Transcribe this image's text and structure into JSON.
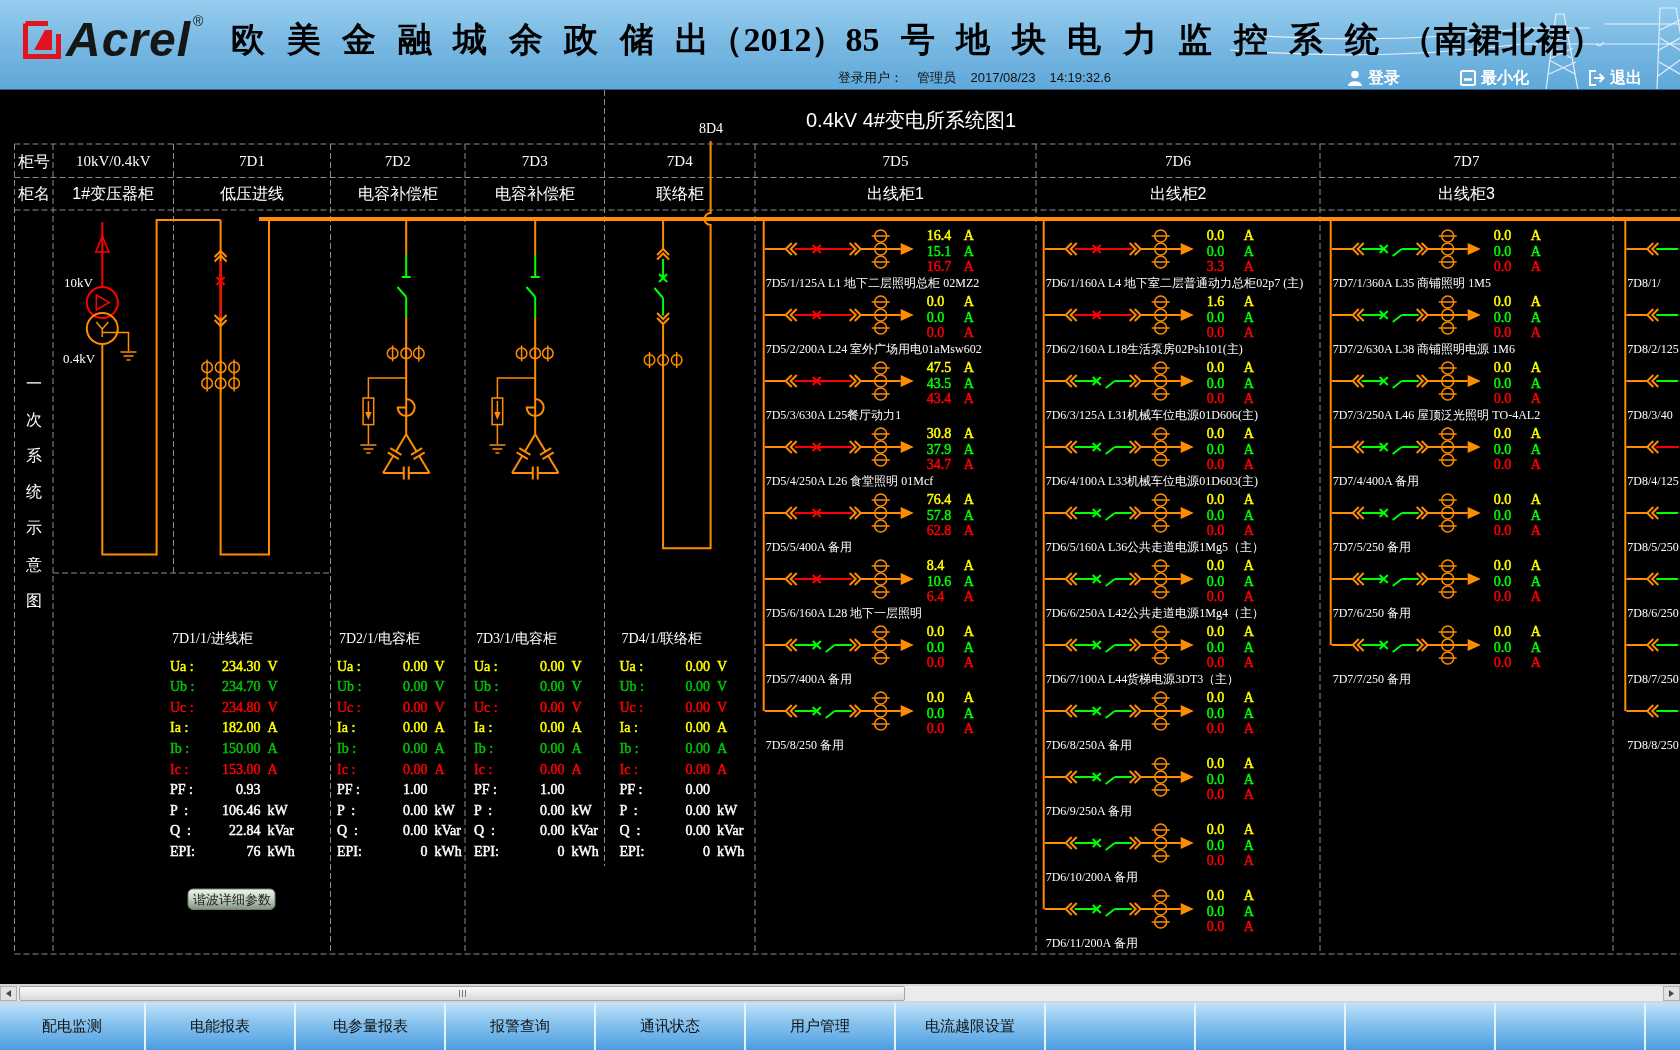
{
  "header": {
    "logo": "Acrel",
    "logo_mark": "®",
    "title": "欧 美 金 融 城 余 政 储 出（2012）85 号 地 块 电 力 监 控 系 统 （南裙北裙）",
    "user_label": "登录用户：",
    "user": "管理员",
    "date": "2017/08/23",
    "time": "14:19:32.6",
    "buttons": [
      {
        "kind": "login",
        "label": "登录"
      },
      {
        "kind": "minimize",
        "label": "最小化"
      },
      {
        "kind": "exit",
        "label": "退出"
      }
    ]
  },
  "diagram": {
    "title": "0.4kV 4#变电所系统图1",
    "side_label": "一次系统示意图",
    "row_labels": [
      "柜号",
      "柜名"
    ],
    "cabinets": [
      {
        "kind": "transformer",
        "number": "10kV/0.4kV",
        "name": "1#变压器柜",
        "hv_label": "10kV",
        "lv_label": "0.4kV"
      },
      {
        "kind": "incoming",
        "number": "7D1",
        "name": "低压进线",
        "closed": true,
        "button": "谐波详细参数",
        "meter": {
          "title": "7D1/1/进线柜",
          "rows": [
            {
              "label": "Ua :",
              "value": "234.30",
              "unit": "V",
              "color": "#ffff00"
            },
            {
              "label": "Ub :",
              "value": "234.70",
              "unit": "V",
              "color": "#00c800"
            },
            {
              "label": "Uc :",
              "value": "234.80",
              "unit": "V",
              "color": "#ff0000"
            },
            {
              "label": "Ia :",
              "value": "182.00",
              "unit": "A",
              "color": "#ffff00"
            },
            {
              "label": "Ib :",
              "value": "150.00",
              "unit": "A",
              "color": "#00c800"
            },
            {
              "label": "Ic :",
              "value": "153.00",
              "unit": "A",
              "color": "#ff0000"
            },
            {
              "label": "PF :",
              "value": "0.93",
              "color": "#ffffff"
            },
            {
              "label": "P  :",
              "value": "106.46",
              "unit": "kW",
              "color": "#ffffff"
            },
            {
              "label": "Q  :",
              "value": "22.84",
              "unit": "kVar",
              "color": "#ffffff"
            },
            {
              "label": "EPI:",
              "value": "76",
              "unit": "kWh",
              "color": "#ffffff"
            }
          ]
        }
      },
      {
        "kind": "capacitor",
        "number": "7D2",
        "name": "电容补偿柜",
        "closed": false,
        "meter": {
          "title": "7D2/1/电容柜",
          "rows": [
            {
              "label": "Ua :",
              "value": "0.00",
              "unit": "V",
              "color": "#ffff00"
            },
            {
              "label": "Ub :",
              "value": "0.00",
              "unit": "V",
              "color": "#00c800"
            },
            {
              "label": "Uc :",
              "value": "0.00",
              "unit": "V",
              "color": "#ff0000"
            },
            {
              "label": "Ia :",
              "value": "0.00",
              "unit": "A",
              "color": "#ffff00"
            },
            {
              "label": "Ib :",
              "value": "0.00",
              "unit": "A",
              "color": "#00c800"
            },
            {
              "label": "Ic :",
              "value": "0.00",
              "unit": "A",
              "color": "#ff0000"
            },
            {
              "label": "PF :",
              "value": "1.00",
              "color": "#ffffff"
            },
            {
              "label": "P  :",
              "value": "0.00",
              "unit": "kW",
              "color": "#ffffff"
            },
            {
              "label": "Q  :",
              "value": "0.00",
              "unit": "kVar",
              "color": "#ffffff"
            },
            {
              "label": "EPI:",
              "value": "0",
              "unit": "kWh",
              "color": "#ffffff"
            }
          ]
        }
      },
      {
        "kind": "capacitor",
        "number": "7D3",
        "name": "电容补偿柜",
        "closed": false,
        "meter": {
          "title": "7D3/1/电容柜",
          "rows": [
            {
              "label": "Ua :",
              "value": "0.00",
              "unit": "V",
              "color": "#ffff00"
            },
            {
              "label": "Ub :",
              "value": "0.00",
              "unit": "V",
              "color": "#00c800"
            },
            {
              "label": "Uc :",
              "value": "0.00",
              "unit": "V",
              "color": "#ff0000"
            },
            {
              "label": "Ia :",
              "value": "0.00",
              "unit": "A",
              "color": "#ffff00"
            },
            {
              "label": "Ib :",
              "value": "0.00",
              "unit": "A",
              "color": "#00c800"
            },
            {
              "label": "Ic :",
              "value": "0.00",
              "unit": "A",
              "color": "#ff0000"
            },
            {
              "label": "PF :",
              "value": "1.00",
              "color": "#ffffff"
            },
            {
              "label": "P  :",
              "value": "0.00",
              "unit": "kW",
              "color": "#ffffff"
            },
            {
              "label": "Q  :",
              "value": "0.00",
              "unit": "kVar",
              "color": "#ffffff"
            },
            {
              "label": "EPI:",
              "value": "0",
              "unit": "kWh",
              "color": "#ffffff"
            }
          ]
        }
      },
      {
        "kind": "tie",
        "number": "7D4",
        "name": "联络柜",
        "closed": false,
        "tie_label": "8D4",
        "meter": {
          "title": "7D4/1/联络柜",
          "rows": [
            {
              "label": "Ua :",
              "value": "0.00",
              "unit": "V",
              "color": "#ffff00"
            },
            {
              "label": "Ub :",
              "value": "0.00",
              "unit": "V",
              "color": "#00c800"
            },
            {
              "label": "Uc :",
              "value": "0.00",
              "unit": "V",
              "color": "#ff0000"
            },
            {
              "label": "Ia :",
              "value": "0.00",
              "unit": "A",
              "color": "#ffff00"
            },
            {
              "label": "Ib :",
              "value": "0.00",
              "unit": "A",
              "color": "#00c800"
            },
            {
              "label": "Ic :",
              "value": "0.00",
              "unit": "A",
              "color": "#ff0000"
            },
            {
              "label": "PF :",
              "value": "0.00",
              "color": "#ffffff"
            },
            {
              "label": "P  :",
              "value": "0.00",
              "unit": "kW",
              "color": "#ffffff"
            },
            {
              "label": "Q  :",
              "value": "0.00",
              "unit": "kVar",
              "color": "#ffffff"
            },
            {
              "label": "EPI:",
              "value": "0",
              "unit": "kWh",
              "color": "#ffffff"
            }
          ]
        }
      },
      {
        "kind": "feeders",
        "number": "7D5",
        "name": "出线柜1",
        "feeders": [
          {
            "label": "7D5/1/125A L1 地下二层照明总柜 02MZ2",
            "closed": true,
            "readings": [
              {
                "value": "16.4",
                "unit": "A",
                "color": "#ffff00"
              },
              {
                "value": "15.1",
                "unit": "A",
                "color": "#00ff00"
              },
              {
                "value": "16.7",
                "unit": "A",
                "color": "#ff0000"
              }
            ]
          },
          {
            "label": "7D5/2/200A L24 室外广场用电01aMsw602",
            "closed": true,
            "readings": [
              {
                "value": "0.0",
                "unit": "A",
                "color": "#ffff00"
              },
              {
                "value": "0.0",
                "unit": "A",
                "color": "#00ff00"
              },
              {
                "value": "0.0",
                "unit": "A",
                "color": "#ff0000"
              }
            ]
          },
          {
            "label": "7D5/3/630A L25餐厅动力1",
            "closed": true,
            "readings": [
              {
                "value": "47.5",
                "unit": "A",
                "color": "#ffff00"
              },
              {
                "value": "43.5",
                "unit": "A",
                "color": "#00ff00"
              },
              {
                "value": "43.4",
                "unit": "A",
                "color": "#ff0000"
              }
            ]
          },
          {
            "label": "7D5/4/250A L26 食堂照明 01Mcf",
            "closed": true,
            "readings": [
              {
                "value": "30.8",
                "unit": "A",
                "color": "#ffff00"
              },
              {
                "value": "37.9",
                "unit": "A",
                "color": "#00ff00"
              },
              {
                "value": "34.7",
                "unit": "A",
                "color": "#ff0000"
              }
            ]
          },
          {
            "label": "7D5/5/400A 备用",
            "closed": true,
            "readings": [
              {
                "value": "76.4",
                "unit": "A",
                "color": "#ffff00"
              },
              {
                "value": "57.8",
                "unit": "A",
                "color": "#00ff00"
              },
              {
                "value": "62.8",
                "unit": "A",
                "color": "#ff0000"
              }
            ]
          },
          {
            "label": "7D5/6/160A L28 地下一层照明",
            "closed": true,
            "readings": [
              {
                "value": "8.4",
                "unit": "A",
                "color": "#ffff00"
              },
              {
                "value": "10.6",
                "unit": "A",
                "color": "#00ff00"
              },
              {
                "value": "6.4",
                "unit": "A",
                "color": "#ff0000"
              }
            ]
          },
          {
            "label": "7D5/7/400A 备用",
            "closed": false,
            "readings": [
              {
                "value": "0.0",
                "unit": "A",
                "color": "#ffff00"
              },
              {
                "value": "0.0",
                "unit": "A",
                "color": "#00ff00"
              },
              {
                "value": "0.0",
                "unit": "A",
                "color": "#ff0000"
              }
            ]
          },
          {
            "label": "7D5/8/250 备用",
            "closed": false,
            "readings": [
              {
                "value": "0.0",
                "unit": "A",
                "color": "#ffff00"
              },
              {
                "value": "0.0",
                "unit": "A",
                "color": "#00ff00"
              },
              {
                "value": "0.0",
                "unit": "A",
                "color": "#ff0000"
              }
            ]
          }
        ]
      },
      {
        "kind": "feeders",
        "number": "7D6",
        "name": "出线柜2",
        "feeders": [
          {
            "label": "7D6/1/160A L4 地下室二层普通动力总柜02p7 (主)",
            "closed": true,
            "readings": [
              {
                "value": "0.0",
                "unit": "A",
                "color": "#ffff00"
              },
              {
                "value": "0.0",
                "unit": "A",
                "color": "#00ff00"
              },
              {
                "value": "3.3",
                "unit": "A",
                "color": "#ff0000"
              }
            ]
          },
          {
            "label": "7D6/2/160A L18生活泵房02Psh101(主)",
            "closed": true,
            "readings": [
              {
                "value": "1.6",
                "unit": "A",
                "color": "#ffff00"
              },
              {
                "value": "0.0",
                "unit": "A",
                "color": "#00ff00"
              },
              {
                "value": "0.0",
                "unit": "A",
                "color": "#ff0000"
              }
            ]
          },
          {
            "label": "7D6/3/125A L31机械车位电源01D606(主)",
            "closed": false,
            "readings": [
              {
                "value": "0.0",
                "unit": "A",
                "color": "#ffff00"
              },
              {
                "value": "0.0",
                "unit": "A",
                "color": "#00ff00"
              },
              {
                "value": "0.0",
                "unit": "A",
                "color": "#ff0000"
              }
            ]
          },
          {
            "label": "7D6/4/100A L33机械车位电源01D603(主)",
            "closed": false,
            "readings": [
              {
                "value": "0.0",
                "unit": "A",
                "color": "#ffff00"
              },
              {
                "value": "0.0",
                "unit": "A",
                "color": "#00ff00"
              },
              {
                "value": "0.0",
                "unit": "A",
                "color": "#ff0000"
              }
            ]
          },
          {
            "label": "7D6/5/160A L36公共走道电源1Mg5（主）",
            "closed": false,
            "readings": [
              {
                "value": "0.0",
                "unit": "A",
                "color": "#ffff00"
              },
              {
                "value": "0.0",
                "unit": "A",
                "color": "#00ff00"
              },
              {
                "value": "0.0",
                "unit": "A",
                "color": "#ff0000"
              }
            ]
          },
          {
            "label": "7D6/6/250A L42公共走道电源1Mg4（主）",
            "closed": false,
            "readings": [
              {
                "value": "0.0",
                "unit": "A",
                "color": "#ffff00"
              },
              {
                "value": "0.0",
                "unit": "A",
                "color": "#00ff00"
              },
              {
                "value": "0.0",
                "unit": "A",
                "color": "#ff0000"
              }
            ]
          },
          {
            "label": "7D6/7/100A L44货梯电源3DT3（主）",
            "closed": false,
            "readings": [
              {
                "value": "0.0",
                "unit": "A",
                "color": "#ffff00"
              },
              {
                "value": "0.0",
                "unit": "A",
                "color": "#00ff00"
              },
              {
                "value": "0.0",
                "unit": "A",
                "color": "#ff0000"
              }
            ]
          },
          {
            "label": "7D6/8/250A 备用",
            "closed": false,
            "readings": [
              {
                "value": "0.0",
                "unit": "A",
                "color": "#ffff00"
              },
              {
                "value": "0.0",
                "unit": "A",
                "color": "#00ff00"
              },
              {
                "value": "0.0",
                "unit": "A",
                "color": "#ff0000"
              }
            ]
          },
          {
            "label": "7D6/9/250A 备用",
            "closed": false,
            "readings": [
              {
                "value": "0.0",
                "unit": "A",
                "color": "#ffff00"
              },
              {
                "value": "0.0",
                "unit": "A",
                "color": "#00ff00"
              },
              {
                "value": "0.0",
                "unit": "A",
                "color": "#ff0000"
              }
            ]
          },
          {
            "label": "7D6/10/200A 备用",
            "closed": false,
            "readings": [
              {
                "value": "0.0",
                "unit": "A",
                "color": "#ffff00"
              },
              {
                "value": "0.0",
                "unit": "A",
                "color": "#00ff00"
              },
              {
                "value": "0.0",
                "unit": "A",
                "color": "#ff0000"
              }
            ]
          },
          {
            "label": "7D6/11/200A 备用",
            "closed": false,
            "readings": [
              {
                "value": "0.0",
                "unit": "A",
                "color": "#ffff00"
              },
              {
                "value": "0.0",
                "unit": "A",
                "color": "#00ff00"
              },
              {
                "value": "0.0",
                "unit": "A",
                "color": "#ff0000"
              }
            ]
          }
        ]
      },
      {
        "kind": "feeders",
        "number": "7D7",
        "name": "出线柜3",
        "feeders": [
          {
            "label": "7D7/1/360A L35 商铺照明 1M5",
            "closed": false,
            "readings": [
              {
                "value": "0.0",
                "unit": "A",
                "color": "#ffff00"
              },
              {
                "value": "0.0",
                "unit": "A",
                "color": "#00ff00"
              },
              {
                "value": "0.0",
                "unit": "A",
                "color": "#ff0000"
              }
            ]
          },
          {
            "label": "7D7/2/630A L38 商铺照明电源 1M6",
            "closed": false,
            "readings": [
              {
                "value": "0.0",
                "unit": "A",
                "color": "#ffff00"
              },
              {
                "value": "0.0",
                "unit": "A",
                "color": "#00ff00"
              },
              {
                "value": "0.0",
                "unit": "A",
                "color": "#ff0000"
              }
            ]
          },
          {
            "label": "7D7/3/250A L46 屋顶泛光照明 TO-4AL2",
            "closed": false,
            "readings": [
              {
                "value": "0.0",
                "unit": "A",
                "color": "#ffff00"
              },
              {
                "value": "0.0",
                "unit": "A",
                "color": "#00ff00"
              },
              {
                "value": "0.0",
                "unit": "A",
                "color": "#ff0000"
              }
            ]
          },
          {
            "label": "7D7/4/400A 备用",
            "closed": false,
            "readings": [
              {
                "value": "0.0",
                "unit": "A",
                "color": "#ffff00"
              },
              {
                "value": "0.0",
                "unit": "A",
                "color": "#00ff00"
              },
              {
                "value": "0.0",
                "unit": "A",
                "color": "#ff0000"
              }
            ]
          },
          {
            "label": "7D7/5/250 备用",
            "closed": false,
            "readings": [
              {
                "value": "0.0",
                "unit": "A",
                "color": "#ffff00"
              },
              {
                "value": "0.0",
                "unit": "A",
                "color": "#00ff00"
              },
              {
                "value": "0.0",
                "unit": "A",
                "color": "#ff0000"
              }
            ]
          },
          {
            "label": "7D7/6/250 备用",
            "closed": false,
            "readings": [
              {
                "value": "0.0",
                "unit": "A",
                "color": "#ffff00"
              },
              {
                "value": "0.0",
                "unit": "A",
                "color": "#00ff00"
              },
              {
                "value": "0.0",
                "unit": "A",
                "color": "#ff0000"
              }
            ]
          },
          {
            "label": "7D7/7/250 备用",
            "closed": false,
            "readings": [
              {
                "value": "0.0",
                "unit": "A",
                "color": "#ffff00"
              },
              {
                "value": "0.0",
                "unit": "A",
                "color": "#00ff00"
              },
              {
                "value": "0.0",
                "unit": "A",
                "color": "#ff0000"
              }
            ]
          }
        ]
      },
      {
        "kind": "feeders",
        "feeders": [
          {
            "label": "7D8/1/",
            "closed": false
          },
          {
            "label": "7D8/2/125",
            "closed": false
          },
          {
            "label": "7D8/3/40",
            "closed": false
          },
          {
            "label": "7D8/4/125",
            "closed": true
          },
          {
            "label": "7D8/5/250",
            "closed": false
          },
          {
            "label": "7D8/6/250",
            "closed": false
          },
          {
            "label": "7D8/7/250",
            "closed": false
          },
          {
            "label": "7D8/8/250",
            "closed": false
          }
        ]
      }
    ]
  },
  "tabs": [
    "配电监测",
    "电能报表",
    "电参量报表",
    "报警查询",
    "通讯状态",
    "用户管理",
    "电流越限设置"
  ]
}
